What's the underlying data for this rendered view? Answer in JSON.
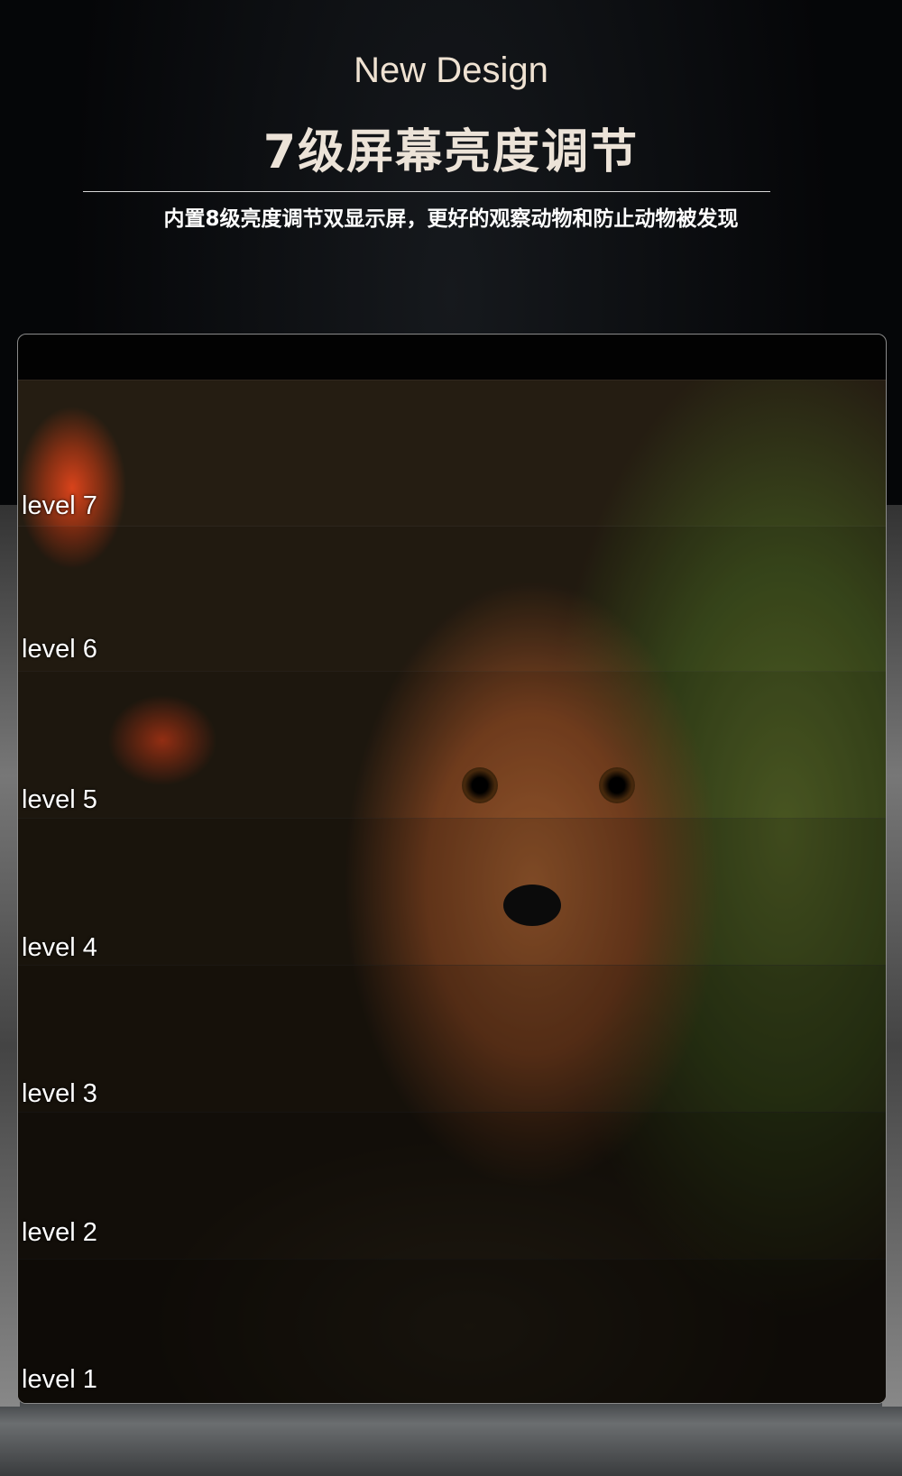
{
  "header": {
    "title_en": "New Design",
    "title_cn": "7级屏幕亮度调节",
    "subtitle": "内置8级亮度调节双显示屏，更好的观察动物和防止动物被发现"
  },
  "levels": [
    {
      "label": "level 7",
      "brightness": 1.0
    },
    {
      "label": "level 6",
      "brightness": 0.9
    },
    {
      "label": "level 5",
      "brightness": 0.8
    },
    {
      "label": "level 4",
      "brightness": 0.7
    },
    {
      "label": "level 3",
      "brightness": 0.6
    },
    {
      "label": "level 2",
      "brightness": 0.5
    },
    {
      "label": "level 1",
      "brightness": 0.4
    }
  ]
}
